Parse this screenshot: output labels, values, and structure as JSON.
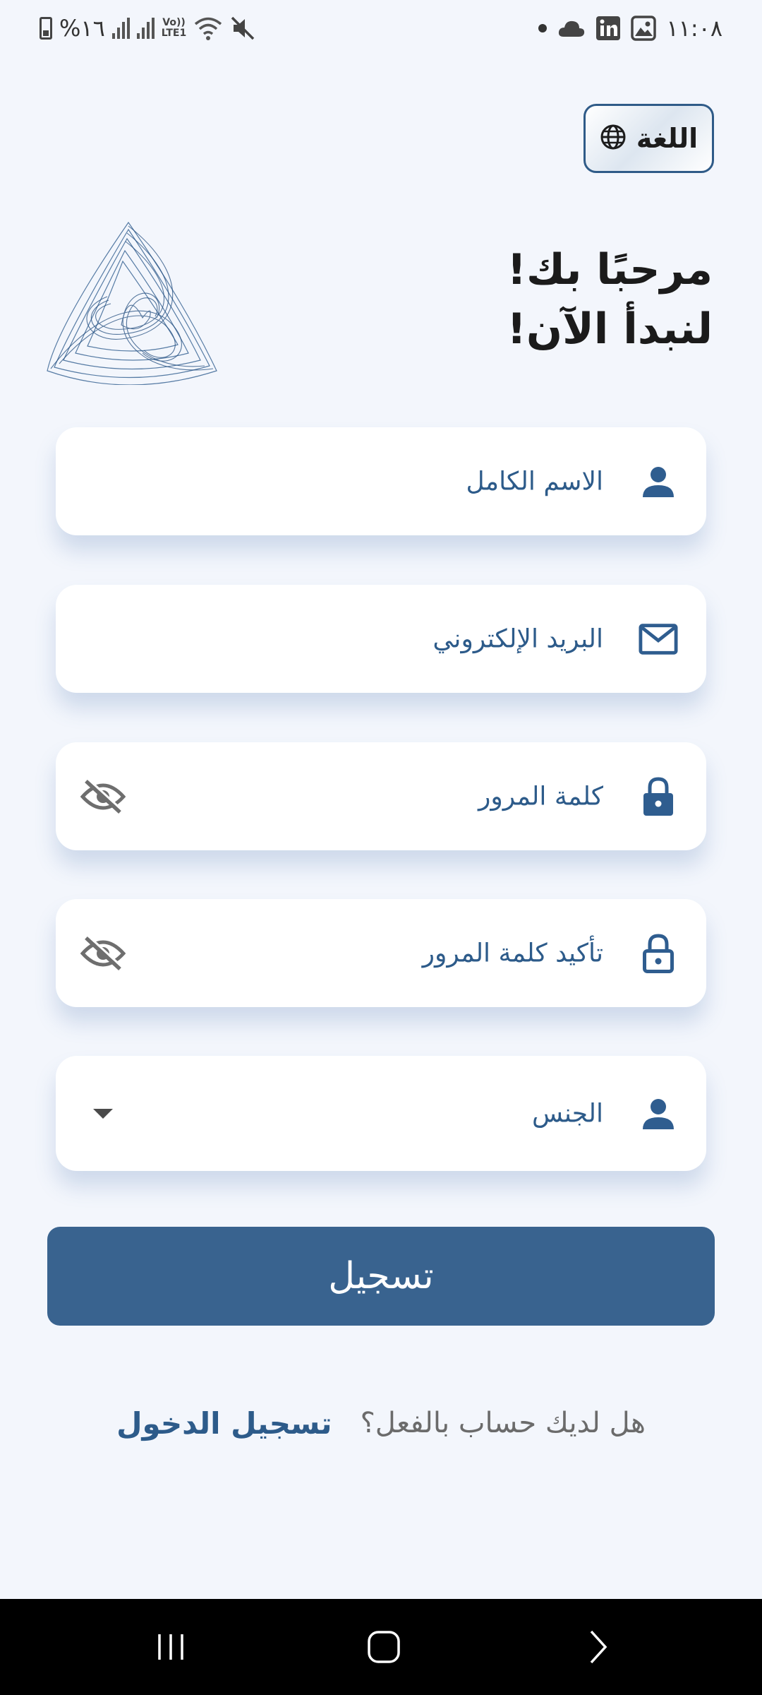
{
  "status_bar": {
    "time": "١١:٠٨",
    "battery": "%١٦",
    "network_label": "LTE1",
    "volte_label": "Vo))"
  },
  "language_button": {
    "label": "اللغة",
    "icon": "globe-icon"
  },
  "heading": {
    "line1": "مرحبًا بك!",
    "line2": "لنبدأ الآن!"
  },
  "form": {
    "full_name": {
      "placeholder": "الاسم الكامل",
      "icon": "person-icon"
    },
    "email": {
      "placeholder": "البريد الإلكتروني",
      "icon": "mail-icon"
    },
    "password": {
      "placeholder": "كلمة المرور",
      "icon": "lock-icon",
      "toggle_icon": "eye-off-icon"
    },
    "confirm_password": {
      "placeholder": "تأكيد كلمة المرور",
      "icon": "lock-outline-icon",
      "toggle_icon": "eye-off-icon"
    },
    "gender": {
      "placeholder": "الجنس",
      "icon": "person-icon",
      "dropdown_icon": "caret-down-icon"
    }
  },
  "register_button": {
    "label": "تسجيل"
  },
  "login_prompt": {
    "text": "هل لديك حساب بالفعل؟",
    "link": "تسجيل الدخول"
  },
  "colors": {
    "primary": "#39638f",
    "label": "#2d5b8a",
    "background": "#f3f6fc"
  }
}
